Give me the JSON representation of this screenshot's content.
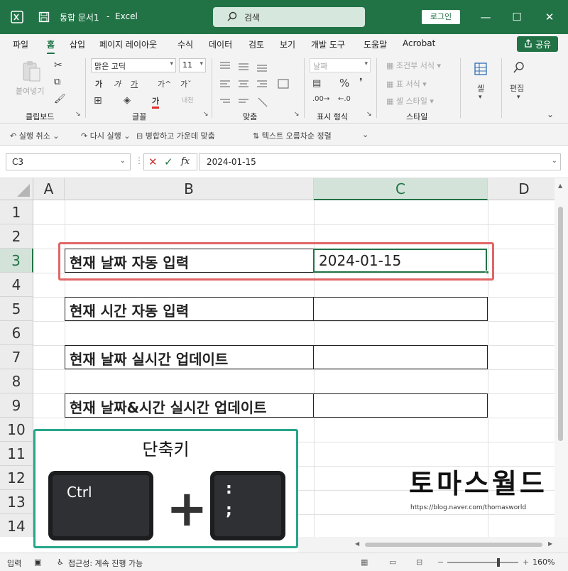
{
  "titlebar": {
    "doc_title": "통합 문서1",
    "separator": "-",
    "app_name": "Excel",
    "search_placeholder": "검색",
    "login_label": "로그인",
    "minimize": "—",
    "maximize": "☐",
    "close": "✕"
  },
  "menu": {
    "tabs": [
      "파일",
      "홈",
      "삽입",
      "페이지 레이아웃",
      "수식",
      "데이터",
      "검토",
      "보기",
      "개발 도구",
      "도움말",
      "Acrobat"
    ],
    "share_label": "공유"
  },
  "ribbon": {
    "clipboard": {
      "paste": "붙여넣기",
      "label": "클립보드"
    },
    "font": {
      "name": "맑은 고딕",
      "size": "11",
      "bold": "가",
      "italic": "가",
      "underline": "가",
      "grow": "가^",
      "shrink": "가ˇ",
      "label": "글꼴",
      "phonetic": "내천"
    },
    "alignment": {
      "label": "맞춤"
    },
    "number": {
      "format": "날짜",
      "label": "표시 형식"
    },
    "styles": {
      "conditional": "조건부 서식",
      "table": "표 서식",
      "cell_styles": "셀 스타일",
      "label": "스타일"
    },
    "cells": {
      "label": "셀"
    },
    "editing": {
      "label": "편집"
    }
  },
  "qat": {
    "undo": "실행 취소",
    "redo": "다시 실행",
    "merge": "병합하고 가운데 맞춤",
    "sort": "텍스트 오름차순 정렬"
  },
  "formula_bar": {
    "name_box": "C3",
    "fx": "fx",
    "value": "2024-01-15"
  },
  "sheet": {
    "columns": [
      "A",
      "B",
      "C",
      "D"
    ],
    "rows": [
      "1",
      "2",
      "3",
      "4",
      "5",
      "6",
      "7",
      "8",
      "9",
      "10",
      "11",
      "12",
      "13",
      "14"
    ],
    "labels": {
      "r3": "현재 날짜 자동 입력",
      "r5": "현재 시간 자동 입력",
      "r7": "현재 날짜 실시간 업데이트",
      "r9": "현재 날짜&시간 실시간 업데이트"
    },
    "c3_value": "2024-01-15"
  },
  "overlay": {
    "title": "단축키",
    "key1": "Ctrl",
    "plus": "+",
    "key2_top": ":",
    "key2_bottom": ";"
  },
  "watermark": {
    "logo": "토마스월드",
    "url": "https://blog.naver.com/thomasworld"
  },
  "statusbar": {
    "mode": "입력",
    "accessibility": "접근성: 계속 진행 가능",
    "zoom": "160%"
  },
  "colors": {
    "excel_green": "#217346",
    "highlight_red": "#e06666",
    "overlay_border": "#27a68a"
  }
}
